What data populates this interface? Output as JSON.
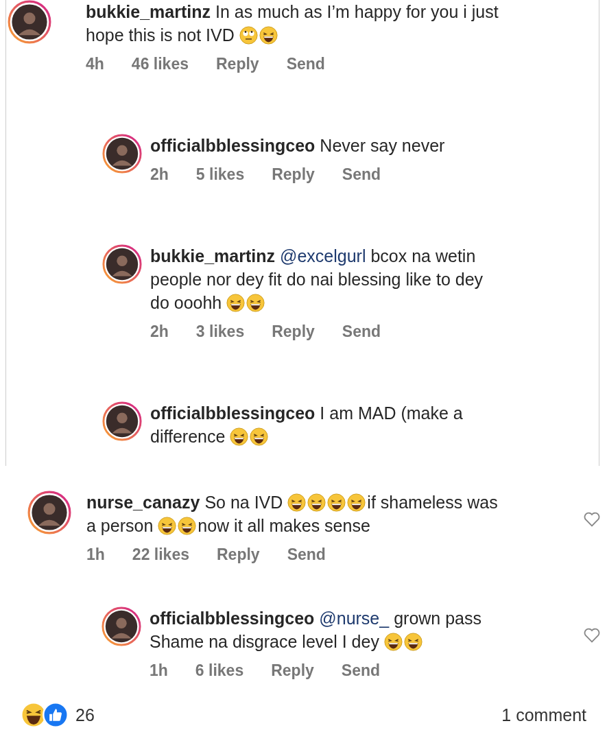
{
  "thread": [
    {
      "is_reply": false,
      "username": "bukkie_martinz",
      "lines": [
        [
          {
            "kind": "text",
            "text": "In as much as I’m happy for you i just"
          }
        ],
        [
          {
            "kind": "text",
            "text": "hope this is not IVD"
          },
          {
            "kind": "eyeroll"
          },
          {
            "kind": "laugh"
          }
        ]
      ],
      "meta": [
        "4h",
        "46 likes",
        "Reply",
        "Send"
      ],
      "like_button": false
    },
    {
      "is_reply": true,
      "username": "officialbblessingceo",
      "lines": [
        [
          {
            "kind": "text",
            "text": "Never say never"
          }
        ]
      ],
      "meta": [
        "2h",
        "5 likes",
        "Reply",
        "Send"
      ],
      "like_button": false
    },
    {
      "is_reply": true,
      "username": "bukkie_martinz",
      "lines": [
        [
          {
            "kind": "mention",
            "text": "@excelgurl"
          },
          {
            "kind": "text",
            "text": "bcox na wetin"
          }
        ],
        [
          {
            "kind": "text",
            "text": "people nor dey fit do nai blessing like to dey"
          }
        ],
        [
          {
            "kind": "text",
            "text": "do ooohh"
          },
          {
            "kind": "laugh"
          },
          {
            "kind": "laugh"
          }
        ]
      ],
      "meta": [
        "2h",
        "3 likes",
        "Reply",
        "Send"
      ],
      "like_button": false
    },
    {
      "is_reply": true,
      "username": "officialbblessingceo",
      "lines": [
        [
          {
            "kind": "text",
            "text": "I am MAD (make a"
          }
        ],
        [
          {
            "kind": "text",
            "text": "difference"
          },
          {
            "kind": "laugh"
          },
          {
            "kind": "laugh"
          }
        ]
      ],
      "like_button": false
    }
  ],
  "comments": [
    {
      "is_reply": false,
      "username": "nurse_canazy",
      "lines": [
        [
          {
            "kind": "text",
            "text": "So na IVD"
          },
          {
            "kind": "laugh"
          },
          {
            "kind": "laugh"
          },
          {
            "kind": "laugh"
          },
          {
            "kind": "laugh"
          },
          {
            "kind": "text",
            "text": "if shameless was"
          }
        ],
        [
          {
            "kind": "text",
            "text": "a person"
          },
          {
            "kind": "laugh"
          },
          {
            "kind": "laugh"
          },
          {
            "kind": "text",
            "text": "now it all makes sense"
          }
        ]
      ],
      "meta": [
        "1h",
        "22 likes",
        "Reply",
        "Send"
      ],
      "like_button": true
    },
    {
      "is_reply": true,
      "username": "officialbblessingceo",
      "lines": [
        [
          {
            "kind": "mention",
            "text": "@nurse_"
          },
          {
            "kind": "text",
            "text": "grown pass"
          }
        ],
        [
          {
            "kind": "text",
            "text": "Shame na disgrace level I dey"
          },
          {
            "kind": "laugh"
          },
          {
            "kind": "laugh"
          }
        ]
      ],
      "meta": [
        "1h",
        "6 likes",
        "Reply",
        "Send"
      ],
      "like_button": true
    }
  ],
  "reactions": {
    "icons": [
      {
        "kind": "haha"
      },
      {
        "kind": "like"
      }
    ],
    "count": "26"
  },
  "comment_count": "1 comment"
}
